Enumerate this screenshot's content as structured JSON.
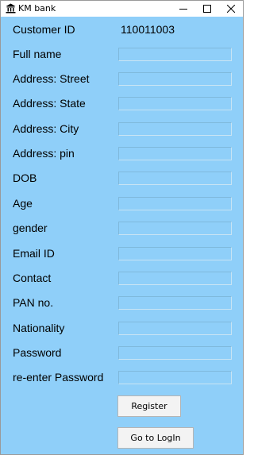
{
  "window": {
    "title": "KM bank"
  },
  "customer_id": {
    "label": "Customer ID",
    "value": "110011003"
  },
  "fields": [
    {
      "label": "Full name",
      "value": ""
    },
    {
      "label": "Address: Street",
      "value": ""
    },
    {
      "label": "Address: State",
      "value": ""
    },
    {
      "label": "Address: City",
      "value": ""
    },
    {
      "label": "Address: pin",
      "value": ""
    },
    {
      "label": "DOB",
      "value": ""
    },
    {
      "label": "Age",
      "value": ""
    },
    {
      "label": "gender",
      "value": ""
    },
    {
      "label": "Email ID",
      "value": ""
    },
    {
      "label": "Contact",
      "value": ""
    },
    {
      "label": "PAN no.",
      "value": ""
    },
    {
      "label": "Nationality",
      "value": ""
    },
    {
      "label": "Password",
      "value": ""
    },
    {
      "label": "re-enter Password",
      "value": ""
    }
  ],
  "buttons": {
    "register": "Register",
    "login": "Go to LogIn"
  },
  "colors": {
    "background": "#8fcff9",
    "button": "#f3f3f3"
  }
}
